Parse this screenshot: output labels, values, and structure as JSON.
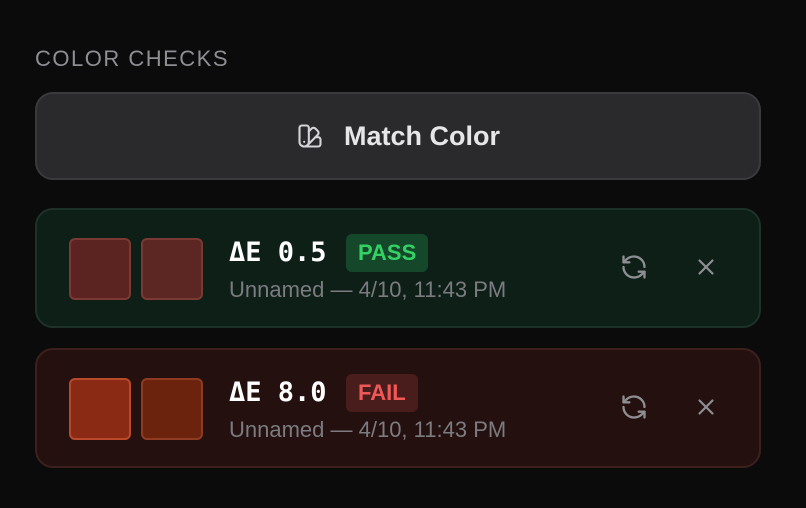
{
  "section_title": "COLOR CHECKS",
  "match_button": {
    "label": "Match Color",
    "icon": "swatch-book-icon"
  },
  "checks": [
    {
      "delta": "ΔE 0.5",
      "status": "PASS",
      "meta": "Unnamed — 4/10, 11:43 PM",
      "swatches": [
        {
          "fill": "#5b2420",
          "border": "#7a3a33"
        },
        {
          "fill": "#5c2623",
          "border": "#7a3a33"
        }
      ]
    },
    {
      "delta": "ΔE 8.0",
      "status": "FAIL",
      "meta": "Unnamed — 4/10, 11:43 PM",
      "swatches": [
        {
          "fill": "#8b2a14",
          "border": "#b84a2a"
        },
        {
          "fill": "#6b230e",
          "border": "#8e3b22"
        }
      ]
    }
  ],
  "colors": {
    "background": "#0b0b0c",
    "pass_text": "#34d164",
    "fail_text": "#f05858",
    "icon": "#8e8e93"
  }
}
